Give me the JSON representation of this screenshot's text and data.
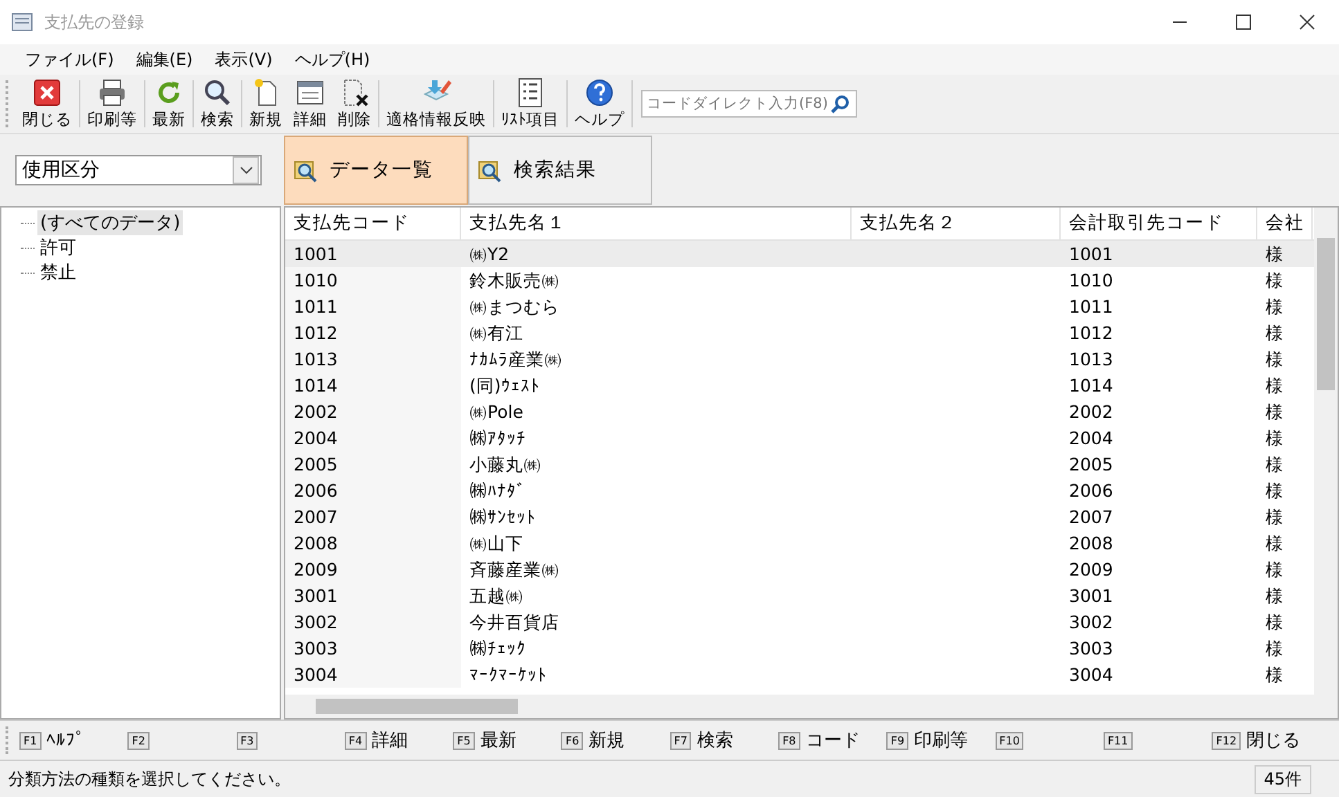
{
  "window": {
    "title": "支払先の登録"
  },
  "menu": [
    "ファイル(F)",
    "編集(E)",
    "表示(V)",
    "ヘルプ(H)"
  ],
  "toolbar": [
    {
      "label": "閉じる"
    },
    {
      "label": "印刷等"
    },
    {
      "label": "最新"
    },
    {
      "label": "検索"
    },
    {
      "label": "新規"
    },
    {
      "label": "詳細"
    },
    {
      "label": "削除"
    },
    {
      "label": "適格情報反映"
    },
    {
      "label": "ﾘｽﾄ項目"
    },
    {
      "label": "ヘルプ"
    }
  ],
  "code_search": {
    "placeholder": "コードダイレクト入力(F8)"
  },
  "category_select": {
    "value": "使用区分"
  },
  "tabs": [
    {
      "label": "データ一覧",
      "selected": true
    },
    {
      "label": "検索結果",
      "selected": false
    }
  ],
  "tree": [
    {
      "label": "(すべてのデータ)",
      "selected": true
    },
    {
      "label": "許可",
      "selected": false
    },
    {
      "label": "禁止",
      "selected": false
    }
  ],
  "table": {
    "columns": [
      "支払先コード",
      "支払先名１",
      "支払先名２",
      "会計取引先コード",
      "会社"
    ],
    "rows": [
      {
        "cells": [
          "1001",
          "㈱Y2",
          "",
          "1001",
          "様"
        ],
        "selected": true
      },
      {
        "cells": [
          "1010",
          "鈴木販売㈱",
          "",
          "1010",
          "様"
        ],
        "selected": false
      },
      {
        "cells": [
          "1011",
          "㈱まつむら",
          "",
          "1011",
          "様"
        ],
        "selected": false
      },
      {
        "cells": [
          "1012",
          "㈱有江",
          "",
          "1012",
          "様"
        ],
        "selected": false
      },
      {
        "cells": [
          "1013",
          "ﾅｶﾑﾗ産業㈱",
          "",
          "1013",
          "様"
        ],
        "selected": false
      },
      {
        "cells": [
          "1014",
          "(同)ｳｪｽﾄ",
          "",
          "1014",
          "様"
        ],
        "selected": false
      },
      {
        "cells": [
          "2002",
          "㈱Pole",
          "",
          "2002",
          "様"
        ],
        "selected": false
      },
      {
        "cells": [
          "2004",
          "㈱ｱﾀｯﾁ",
          "",
          "2004",
          "様"
        ],
        "selected": false
      },
      {
        "cells": [
          "2005",
          "小藤丸㈱",
          "",
          "2005",
          "様"
        ],
        "selected": false
      },
      {
        "cells": [
          "2006",
          "㈱ﾊﾅﾀﾞ",
          "",
          "2006",
          "様"
        ],
        "selected": false
      },
      {
        "cells": [
          "2007",
          "㈱ｻﾝｾｯﾄ",
          "",
          "2007",
          "様"
        ],
        "selected": false
      },
      {
        "cells": [
          "2008",
          "㈱山下",
          "",
          "2008",
          "様"
        ],
        "selected": false
      },
      {
        "cells": [
          "2009",
          "斉藤産業㈱",
          "",
          "2009",
          "様"
        ],
        "selected": false
      },
      {
        "cells": [
          "3001",
          "五越㈱",
          "",
          "3001",
          "様"
        ],
        "selected": false
      },
      {
        "cells": [
          "3002",
          "今井百貨店",
          "",
          "3002",
          "様"
        ],
        "selected": false
      },
      {
        "cells": [
          "3003",
          "㈱ﾁｪｯｸ",
          "",
          "3003",
          "様"
        ],
        "selected": false
      },
      {
        "cells": [
          "3004",
          "ﾏｰｸﾏｰｹｯﾄ",
          "",
          "3004",
          "様"
        ],
        "selected": false
      }
    ]
  },
  "function_keys": [
    {
      "key": "F1",
      "label": "ﾍﾙﾌﾟ"
    },
    {
      "key": "F2"
    },
    {
      "key": "F3"
    },
    {
      "key": "F4",
      "label": "詳細"
    },
    {
      "key": "F5",
      "label": "最新"
    },
    {
      "key": "F6",
      "label": "新規"
    },
    {
      "key": "F7",
      "label": "検索"
    },
    {
      "key": "F8",
      "label": "コード"
    },
    {
      "key": "F9",
      "label": "印刷等"
    },
    {
      "key": "F10"
    },
    {
      "key": "F11"
    },
    {
      "key": "F12",
      "label": "閉じる"
    }
  ],
  "status_bar": {
    "message": "分類方法の種類を選択してください。",
    "count": "45件"
  }
}
